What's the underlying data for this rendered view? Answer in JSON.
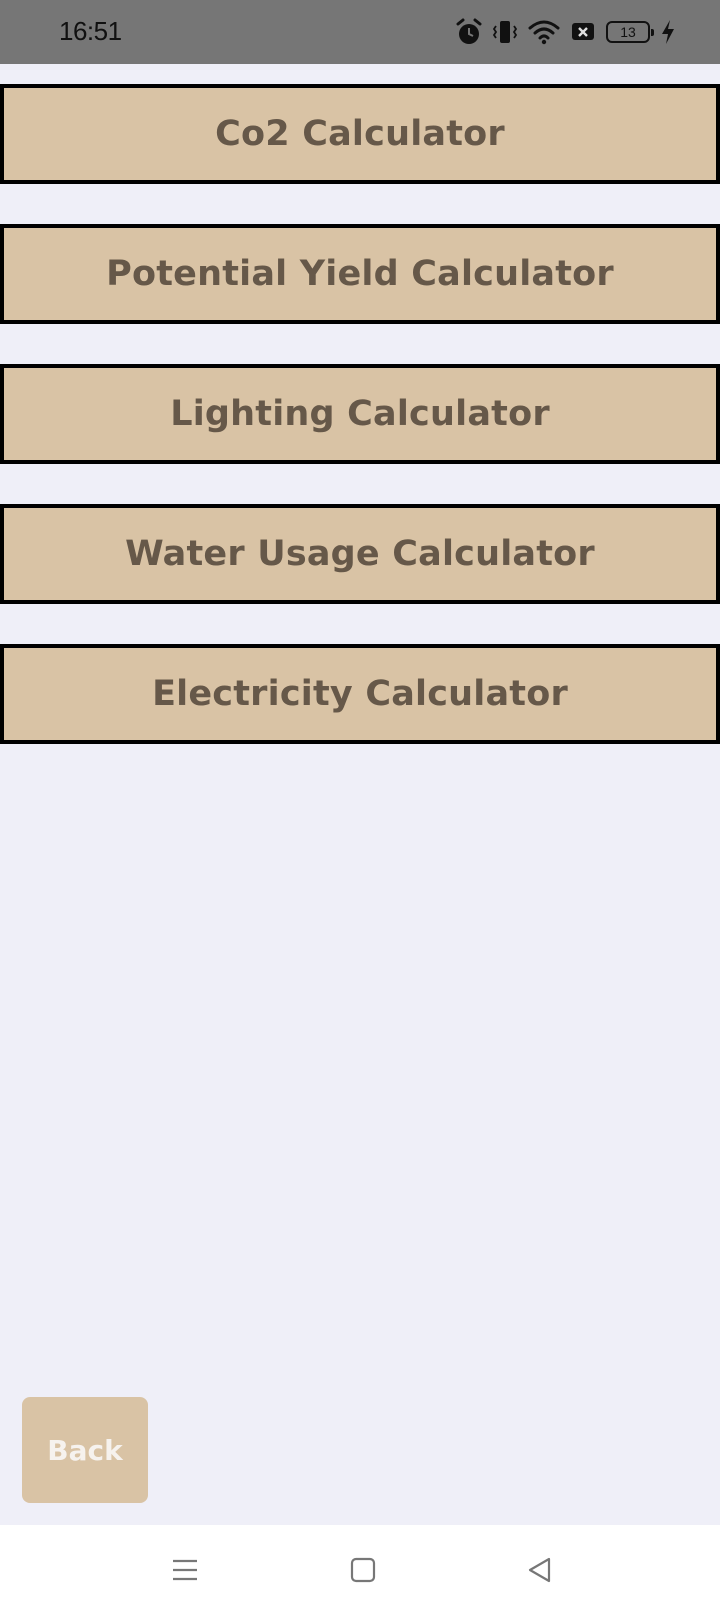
{
  "status_bar": {
    "time": "16:51",
    "battery_level": "13",
    "icons": [
      "alarm-icon",
      "vibrate-icon",
      "wifi-icon",
      "notification-x-icon",
      "battery-icon",
      "charging-bolt-icon"
    ]
  },
  "calculators": [
    {
      "label": "Co2 Calculator"
    },
    {
      "label": "Potential Yield Calculator"
    },
    {
      "label": "Lighting Calculator"
    },
    {
      "label": "Water Usage Calculator"
    },
    {
      "label": "Electricity Calculator"
    }
  ],
  "back_button": {
    "label": "Back"
  },
  "nav_bar": {
    "icons": [
      "menu-icon",
      "home-icon",
      "back-triangle-icon"
    ]
  },
  "colors": {
    "background": "#efeff8",
    "button_fill": "#d9c3a5",
    "button_text": "#665849",
    "button_border": "#000000",
    "status_bar": "#767676",
    "back_text": "#f6f2ee"
  }
}
